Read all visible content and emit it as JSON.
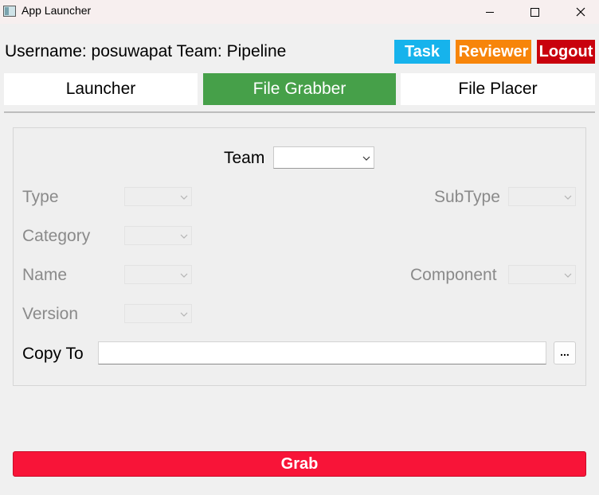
{
  "window": {
    "title": "App Launcher",
    "minimize_icon": "minimize-icon",
    "maximize_icon": "maximize-icon",
    "close_icon": "close-icon"
  },
  "header": {
    "user_info": "Username: posuwapat Team: Pipeline",
    "task_label": "Task",
    "reviewer_label": "Reviewer",
    "logout_label": "Logout",
    "colors": {
      "task": "#16b3ec",
      "reviewer": "#f7850a",
      "logout": "#c9010d"
    }
  },
  "tabs": [
    {
      "label": "Launcher",
      "active": false
    },
    {
      "label": "File Grabber",
      "active": true
    },
    {
      "label": "File Placer",
      "active": false
    }
  ],
  "active_tab_color": "#46a049",
  "form": {
    "team": {
      "label": "Team",
      "value": "",
      "enabled": true
    },
    "type": {
      "label": "Type",
      "value": "",
      "enabled": false
    },
    "subtype": {
      "label": "SubType",
      "value": "",
      "enabled": false
    },
    "category": {
      "label": "Category",
      "value": "",
      "enabled": false
    },
    "name": {
      "label": "Name",
      "value": "",
      "enabled": false
    },
    "component": {
      "label": "Component",
      "value": "",
      "enabled": false
    },
    "version": {
      "label": "Version",
      "value": "",
      "enabled": false
    },
    "copy_to": {
      "label": "Copy To",
      "value": "",
      "browse_label": "..."
    }
  },
  "grab_button": {
    "label": "Grab",
    "color": "#f81438"
  }
}
